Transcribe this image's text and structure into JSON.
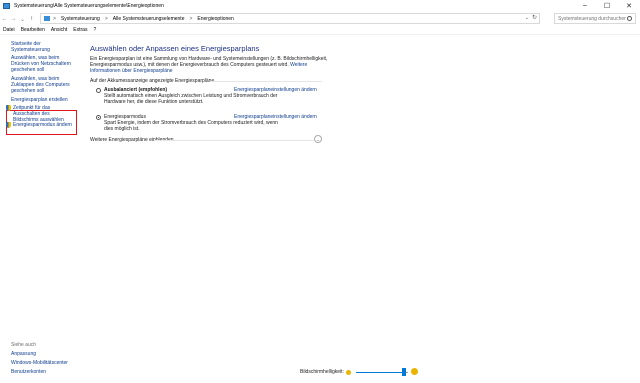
{
  "window": {
    "title": "Systemsteuerung\\Alle Systemsteuerungselemente\\Energieoptionen",
    "controls": {
      "minimize": "–",
      "maximize": "☐",
      "close": "✕"
    }
  },
  "address": {
    "crumbs": [
      "Systemsteuerung",
      "Alle Systemsteuerungselemente",
      "Energieoptionen"
    ],
    "separator": ">",
    "search_placeholder": "Systemsteuerung durchsuchen"
  },
  "menu": [
    "Datei",
    "Bearbeiten",
    "Ansicht",
    "Extras",
    "?"
  ],
  "sidebar": {
    "home": "Startseite der Systemsteuerung",
    "links": [
      "Auswählen, was beim Drücken von Netzschaltern geschehen soll",
      "Auswählen, was beim Zuklappen des Computers geschehen soll",
      "Energiesparplan erstellen",
      "Zeitpunkt für das Ausschalten des Bildschirms auswählen",
      "Energiesparmodus ändern"
    ],
    "see_also_label": "Siehe auch",
    "see_also": [
      "Anpassung",
      "Windows-Mobilitätscenter",
      "Benutzerkonten"
    ]
  },
  "main": {
    "title": "Auswählen oder Anpassen eines Energiesparplans",
    "intro": "Ein Energiesparplan ist eine Sammlung von Hardware- und Systemeinstellungen (z. B. Bildschirmhelligkeit, Energiesparmodus usw.), mit denen der Energieverbrauch des Computers gesteuert wird.",
    "intro_link": "Weitere Informationen über Energiesparpläne",
    "group_label": "Auf der Akkumessanzeige angezeigte Energiesparpläne",
    "plans": [
      {
        "name": "Ausbalanciert (empfohlen)",
        "selected": false,
        "edit_link": "Energiesparplaneinstellungen ändern",
        "description": "Stellt automatisch einen Ausgleich zwischen Leistung und Stromverbrauch der Hardware her, die diese Funktion unterstützt."
      },
      {
        "name": "Energiesparmodus",
        "selected": true,
        "edit_link": "Energiesparplaneinstellungen ändern",
        "description": "Spart Energie, indem der Stromverbrauch des Computers reduziert wird, wenn dies möglich ist."
      }
    ],
    "more_plans": "Weitere Energiesparpläne einblenden"
  },
  "brightness": {
    "label": "Bildschirmhelligkeit:",
    "level_fraction": 0.92
  },
  "colors": {
    "link": "#0e3d8c",
    "title": "#1e3287",
    "highlight": "#e0161a",
    "accent": "#0078d7"
  }
}
